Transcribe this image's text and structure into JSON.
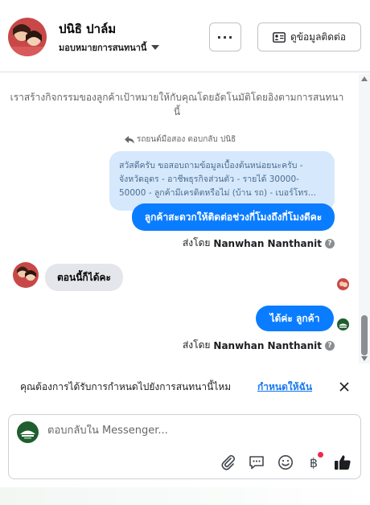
{
  "header": {
    "contact_name": "ปนิธิ ปาล์ม",
    "assign_label": "มอบหมายการสนทนานี้",
    "more_label": "···",
    "contact_info_label": "ดูข้อมูลติดต่อ"
  },
  "thread": {
    "system_note": "เราสร้างกิจกรรมของลูกค้าเป้าหมายให้กับคุณโดยอัตโนมัติโดยอิงตามการสนทนานี้",
    "reply_meta": "รถยนต์มือสอง ตอบกลับ ปนิธิ",
    "quoted_text": "สวัสดีครับ ขอสอบถามข้อมูลเบื้องต้นหน่อยนะครับ - จังหวัดอุดร - อาชีพธุรกิจส่วนตัว - รายได้ 30000-50000 - ลูกค้ามีเครดิตหรือไม่ (บ้าน รถ) - เบอร์โทร...",
    "outgoing_1": "ลูกค้าสะดวกให้ติดต่อช่วงกี่โมงถึงกี่โมงดีคะ",
    "sent_by_prefix": "ส่งโดย",
    "sent_by_name": "Nanwhan Nanthanit",
    "incoming_1": "ตอนนี้ก็ได้คะ",
    "outgoing_2": "ได้ค่ะ ลูกค้า"
  },
  "banner": {
    "text": "คุณต้องการได้รับการกำหนดไปยังการสนทนานี้ไหม",
    "link": "กำหนดให้ฉัน"
  },
  "composer": {
    "placeholder": "ตอบกลับใน Messenger..."
  },
  "colors": {
    "accent": "#0a7cff",
    "link": "#1877f2",
    "quoted_bg": "#d6e8fb",
    "incoming_bg": "#e4e6eb",
    "notification": "#f02849"
  },
  "icons": [
    "more-icon",
    "contact-card-icon",
    "reply-arrow-icon",
    "info-icon",
    "close-icon",
    "attach-icon",
    "speech-bubble-icon",
    "emoji-icon",
    "baht-icon",
    "thumbs-up-icon"
  ]
}
